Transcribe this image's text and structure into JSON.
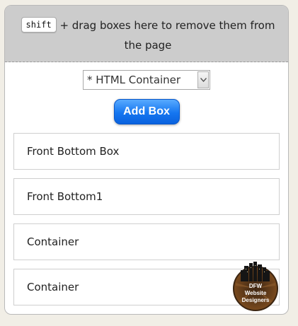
{
  "drop_zone": {
    "key": "shift",
    "instruction": "+ drag boxes here to remove them from the page"
  },
  "controls": {
    "type_select": {
      "value": "* HTML Container"
    },
    "add_button_label": "Add Box"
  },
  "boxes": [
    {
      "label": "Front Bottom Box"
    },
    {
      "label": "Front Bottom1"
    },
    {
      "label": "Container"
    },
    {
      "label": "Container"
    }
  ],
  "logo": {
    "line1": "DFW",
    "line2": "Website",
    "line3": "Designers",
    "colors": {
      "ring": "#7a4a1e",
      "skyline": "#1a1a1a",
      "text": "#ffffff"
    }
  },
  "colors": {
    "drop_zone_bg": "#cccccc",
    "button_blue": "#1576f0",
    "page_bg": "#f1eee6"
  }
}
